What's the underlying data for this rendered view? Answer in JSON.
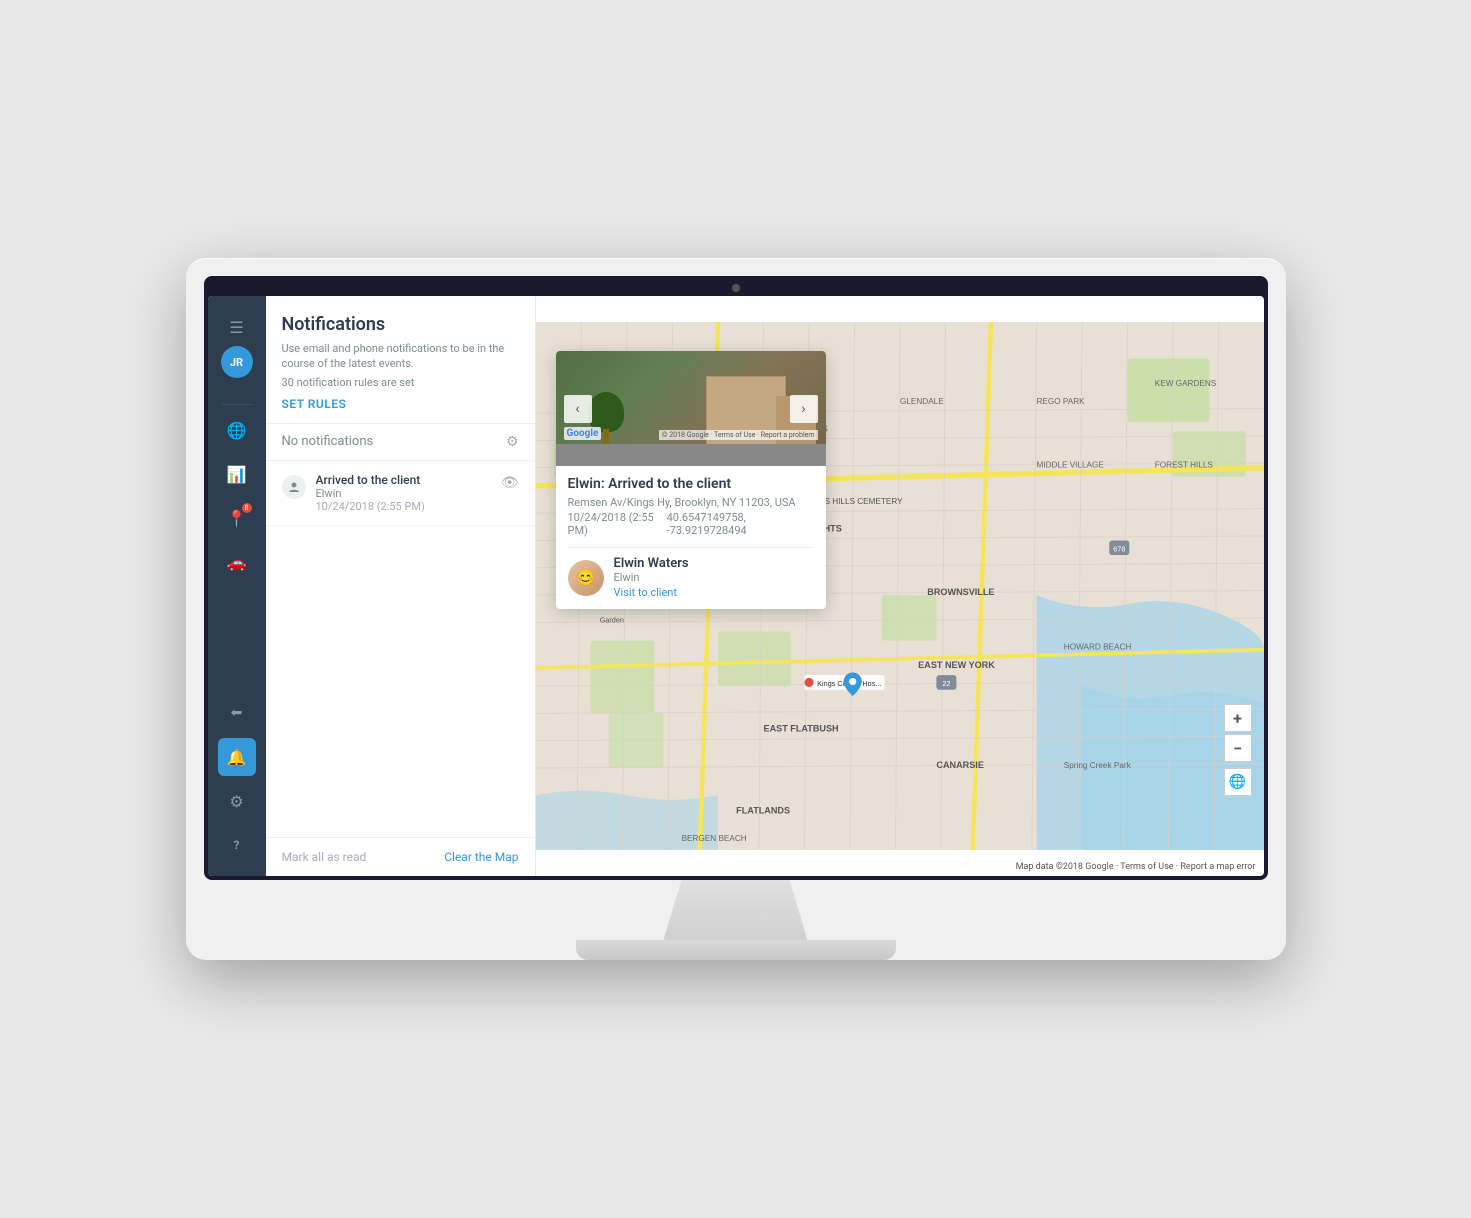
{
  "monitor": {
    "camera_dot": "●"
  },
  "sidebar": {
    "avatar_initials": "JR",
    "items": [
      {
        "id": "menu",
        "icon": "☰",
        "label": "menu",
        "active": false
      },
      {
        "id": "globe",
        "icon": "🌐",
        "label": "globe",
        "active": false
      },
      {
        "id": "chart",
        "icon": "📊",
        "label": "chart",
        "active": false
      },
      {
        "id": "location",
        "icon": "📍",
        "label": "location",
        "badge": "8",
        "active": false
      },
      {
        "id": "vehicle",
        "icon": "🚗",
        "label": "vehicle",
        "active": false
      }
    ],
    "bottom_items": [
      {
        "id": "logout",
        "icon": "⬅",
        "label": "logout"
      },
      {
        "id": "bell",
        "icon": "🔔",
        "label": "notifications",
        "active": true
      },
      {
        "id": "settings",
        "icon": "⚙",
        "label": "settings"
      },
      {
        "id": "help",
        "icon": "?",
        "label": "help"
      }
    ]
  },
  "notifications_panel": {
    "title": "Notifications",
    "description": "Use email and phone notifications to be in the course of the latest events.",
    "rules_count": "30 notification rules are set",
    "set_rules_label": "SET RULES",
    "no_notifications_label": "No notifications",
    "notification_item": {
      "action": "Arrived to the client",
      "user": "Elwin",
      "time": "10/24/2018 (2:55 PM)"
    },
    "footer": {
      "mark_all_read": "Mark all as read",
      "clear_map": "Clear the Map"
    }
  },
  "map_popup": {
    "title": "Elwin: Arrived to the client",
    "address": "Remsen Av/Kings Hy, Brooklyn, NY 11203, USA",
    "datetime": "10/24/2018 (2:55 PM)",
    "coordinates": "40.6547149758, -73.9219728494",
    "google_label": "Google",
    "copyright": "© 2018 Google · Terms of Use · Report a problem",
    "user": {
      "name": "Elwin Waters",
      "role": "Elwin",
      "visit_link": "Visit to client",
      "avatar_emoji": "👤"
    }
  },
  "map": {
    "zoom_plus": "+",
    "zoom_minus": "−",
    "attribution": "Map data ©2018 Google · Terms of Use · Report a map error"
  }
}
